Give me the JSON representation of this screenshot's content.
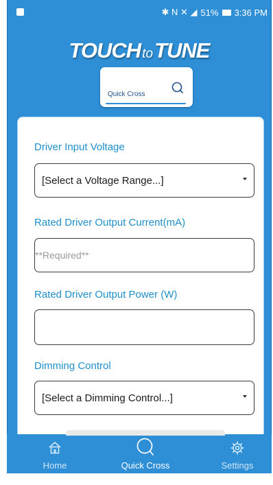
{
  "status_bar": {
    "icons_text": "✱ N ✕ ◢",
    "battery_percent": "51%",
    "time": "3:36 PM"
  },
  "logo": {
    "touch": "TOUCH",
    "to": "to",
    "tune": "TUNE"
  },
  "quick_cross_tab": {
    "label": "Quick Cross",
    "icon": "search-icon"
  },
  "form": {
    "driver_input_voltage": {
      "label": "Driver Input Voltage",
      "value": "[Select a Voltage Range...]"
    },
    "rated_output_current": {
      "label": "Rated Driver Output Current(mA)",
      "placeholder": "**Required**",
      "value": ""
    },
    "rated_output_power": {
      "label": "Rated Driver Output Power (W)",
      "value": ""
    },
    "dimming_control": {
      "label": "Dimming Control",
      "value": "[Select a Dimming Control...]"
    }
  },
  "nav": {
    "items": [
      {
        "label": "Home",
        "icon": "home-icon"
      },
      {
        "label": "Quick Cross",
        "icon": "search-icon",
        "active": true
      },
      {
        "label": "Settings",
        "icon": "gear-icon"
      }
    ]
  },
  "colors": {
    "brand": "#2e8fd6",
    "label": "#1f8fc9",
    "border": "#3a3a3a"
  }
}
